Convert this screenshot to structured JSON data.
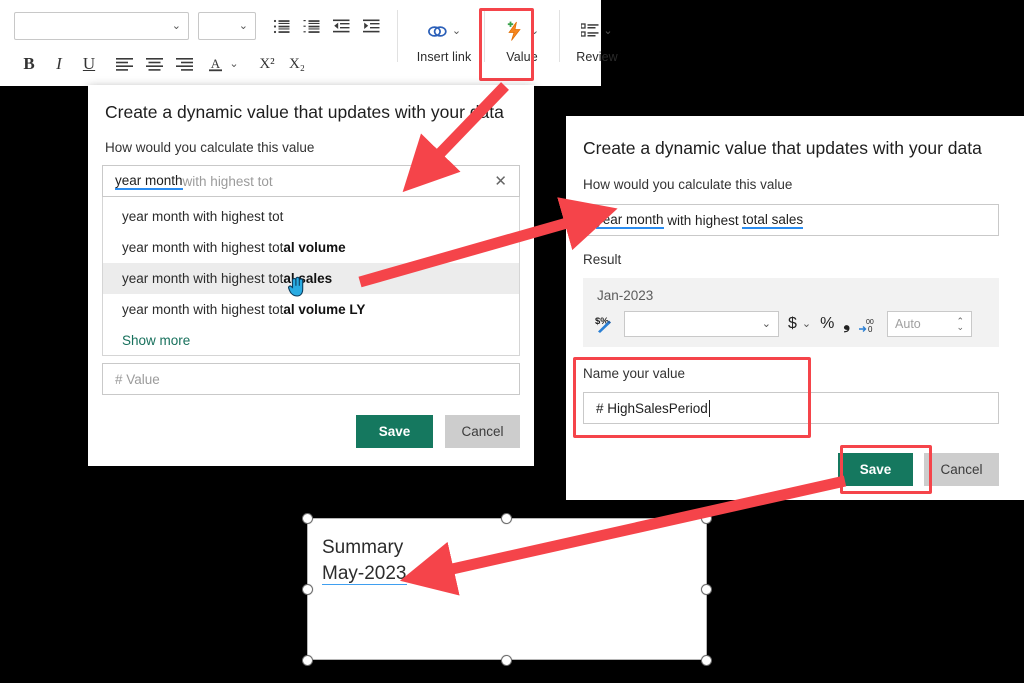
{
  "toolbar": {
    "font_family_value": "",
    "font_size_value": "",
    "buttons": {
      "bold": "B",
      "italic": "I",
      "underline": "U",
      "superscript": "X²",
      "subscript": "X₂"
    },
    "groups": [
      {
        "label": "Insert link",
        "icon": "link-icon"
      },
      {
        "label": "Value",
        "icon": "dynamic-value-icon",
        "highlighted": true
      },
      {
        "label": "Review",
        "icon": "review-list-icon"
      }
    ]
  },
  "dialog_left": {
    "title": "Create a dynamic value that updates with your data",
    "field_label": "How would you calculate this value",
    "query_token": "year month",
    "query_rest": " with highest tot",
    "clear_icon": "close-icon",
    "suggestions": [
      {
        "typed": "year month with highest tot",
        "completion": "",
        "selected": false
      },
      {
        "typed": "year month with highest tot",
        "completion": "al volume",
        "selected": false
      },
      {
        "typed": "year month with highest tot",
        "completion": "al sales",
        "selected": true
      },
      {
        "typed": "year month with highest tot",
        "completion": "al volume LY",
        "selected": false
      }
    ],
    "show_more": "Show more",
    "name_placeholder": "# Value",
    "save_label": "Save",
    "cancel_label": "Cancel"
  },
  "dialog_right": {
    "title": "Create a dynamic value that updates with your data",
    "field_label": "How would you calculate this value",
    "query_tokens": [
      "year month",
      " with highest ",
      "total sales"
    ],
    "result_label": "Result",
    "result_value": "Jan-2023",
    "format": {
      "currency_icon": "currency-format-icon",
      "number_format_value": "",
      "dollar_label": "$",
      "percent_label": "%",
      "comma_label": "❟",
      "decimal_icon": "decrease-decimal-icon",
      "decimals_value": "",
      "decimals_placeholder": "Auto"
    },
    "name_label": "Name your value",
    "name_value": "# HighSalesPeriod",
    "save_label": "Save",
    "cancel_label": "Cancel"
  },
  "textbox": {
    "line1": "Summary",
    "line2": "May-2023"
  },
  "colors": {
    "accent_green": "#15785f",
    "annotation_red": "#f5444a",
    "token_blue": "#2a8cf0",
    "link_teal": "#17705c"
  }
}
